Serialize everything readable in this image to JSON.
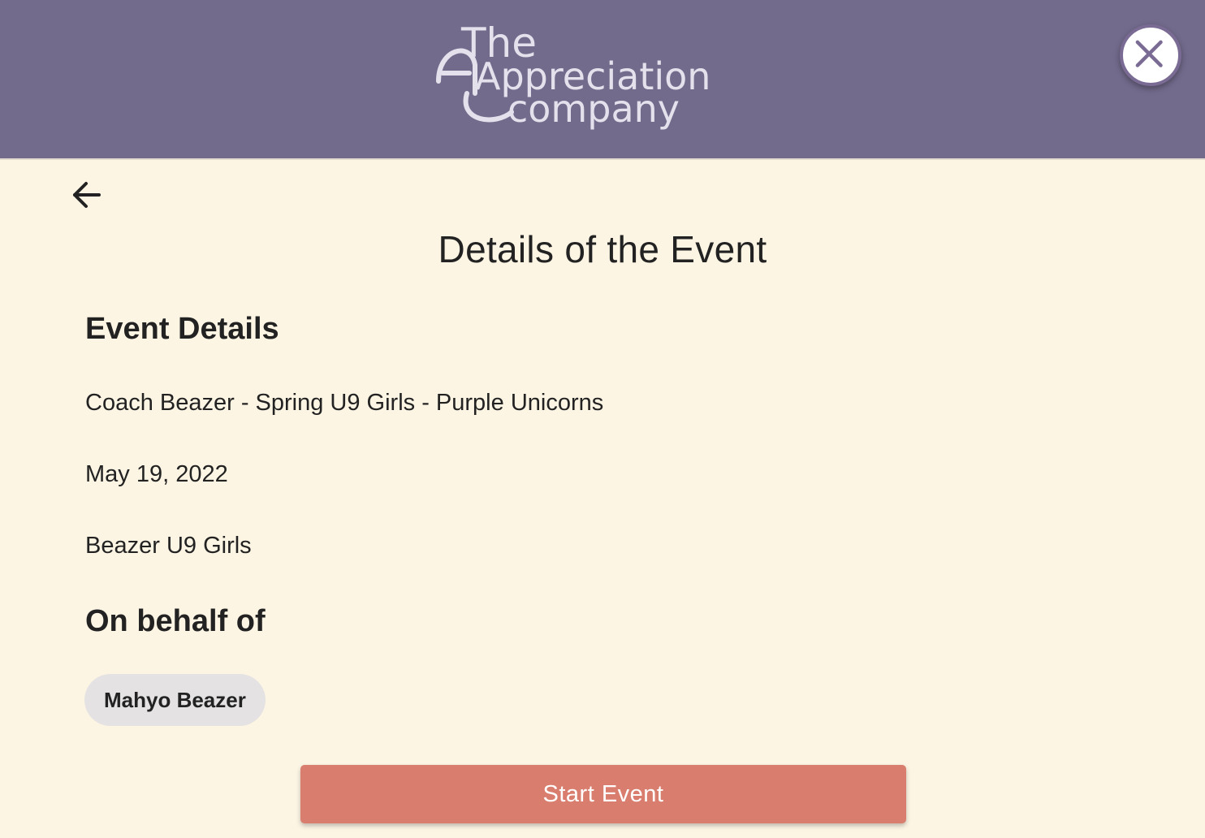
{
  "header": {
    "logo": {
      "line1": "The",
      "line2": "Appreciation",
      "line3": "company",
      "color": "#e4e0ec"
    },
    "background_color": "#736b8c",
    "close_icon": "close-icon"
  },
  "nav": {
    "back_icon": "arrow-left-icon"
  },
  "page": {
    "title": "Details of the Event",
    "background_color": "#fdf5e4"
  },
  "event_details": {
    "heading": "Event Details",
    "name": "Coach Beazer - Spring U9 Girls - Purple Unicorns",
    "date": "May 19, 2022",
    "team": "Beazer U9 Girls"
  },
  "on_behalf_of": {
    "heading": "On behalf of",
    "people": [
      "Mahyo Beazer"
    ]
  },
  "actions": {
    "start_label": "Start Event",
    "start_color": "#d97e6e"
  }
}
